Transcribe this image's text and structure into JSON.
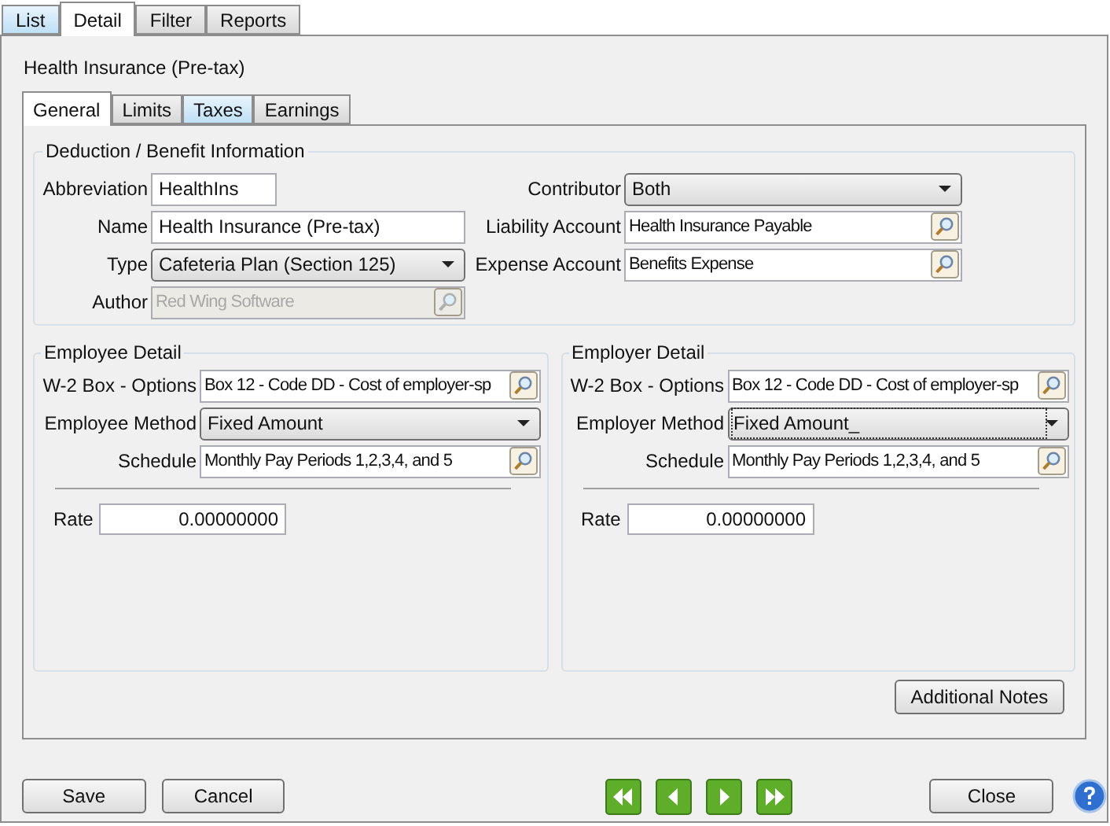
{
  "tabs": [
    {
      "label": "List",
      "selected": false,
      "highlighted": true
    },
    {
      "label": "Detail",
      "selected": true
    },
    {
      "label": "Filter",
      "selected": false,
      "highlighted": false
    },
    {
      "label": "Reports",
      "selected": false,
      "highlighted": false
    }
  ],
  "title": "Health Insurance (Pre-tax)",
  "inner_tabs": [
    {
      "label": "General",
      "selected": true
    },
    {
      "label": "Limits",
      "selected": false,
      "highlighted": false
    },
    {
      "label": "Taxes",
      "selected": false,
      "highlighted": true
    },
    {
      "label": "Earnings",
      "selected": false,
      "highlighted": false
    }
  ],
  "deduction_group": {
    "title": "Deduction / Benefit Information",
    "left_fields": [
      {
        "label": "Abbreviation",
        "kind": "text",
        "value": "HealthIns",
        "disabled": false
      },
      {
        "label": "Name",
        "kind": "text",
        "value": "Health Insurance (Pre-tax)",
        "disabled": false
      },
      {
        "label": "Type",
        "kind": "dropdown",
        "value": "Cafeteria Plan (Section 125)",
        "disabled": false,
        "focused": false
      },
      {
        "label": "Author",
        "kind": "lookup",
        "value": "Red Wing Software",
        "disabled": true
      }
    ],
    "right_fields": [
      {
        "label": "Contributor",
        "kind": "dropdown",
        "value": "Both",
        "disabled": false,
        "focused": false
      },
      {
        "label": "Liability Account",
        "kind": "lookup",
        "value": "Health Insurance Payable",
        "disabled": false
      },
      {
        "label": "Expense Account",
        "kind": "lookup",
        "value": "Benefits Expense",
        "disabled": false
      }
    ]
  },
  "employee_group": {
    "title": "Employee Detail",
    "fields": [
      {
        "label": "W-2 Box - Options",
        "kind": "lookup",
        "value": "Box 12 - Code DD - Cost of employer-sp",
        "disabled": false
      },
      {
        "label": "Employee Method",
        "kind": "dropdown",
        "value": "Fixed Amount",
        "disabled": false,
        "focused": false
      },
      {
        "label": "Schedule",
        "kind": "lookup",
        "value": "Monthly Pay Periods 1,2,3,4, and 5",
        "disabled": false
      }
    ],
    "rate": {
      "label": "Rate",
      "value": "0.00000000"
    }
  },
  "employer_group": {
    "title": "Employer Detail",
    "fields": [
      {
        "label": "W-2 Box - Options",
        "kind": "lookup",
        "value": "Box 12 - Code DD - Cost of employer-sp",
        "disabled": false
      },
      {
        "label": "Employer Method",
        "kind": "dropdown",
        "value": "Fixed Amount_",
        "disabled": false,
        "focused": true
      },
      {
        "label": "Schedule",
        "kind": "lookup",
        "value": "Monthly Pay Periods 1,2,3,4, and 5",
        "disabled": false
      }
    ],
    "rate": {
      "label": "Rate",
      "value": "0.00000000"
    }
  },
  "additional_notes_button": "Additional Notes",
  "footer": {
    "save": "Save",
    "cancel": "Cancel",
    "close": "Close"
  }
}
